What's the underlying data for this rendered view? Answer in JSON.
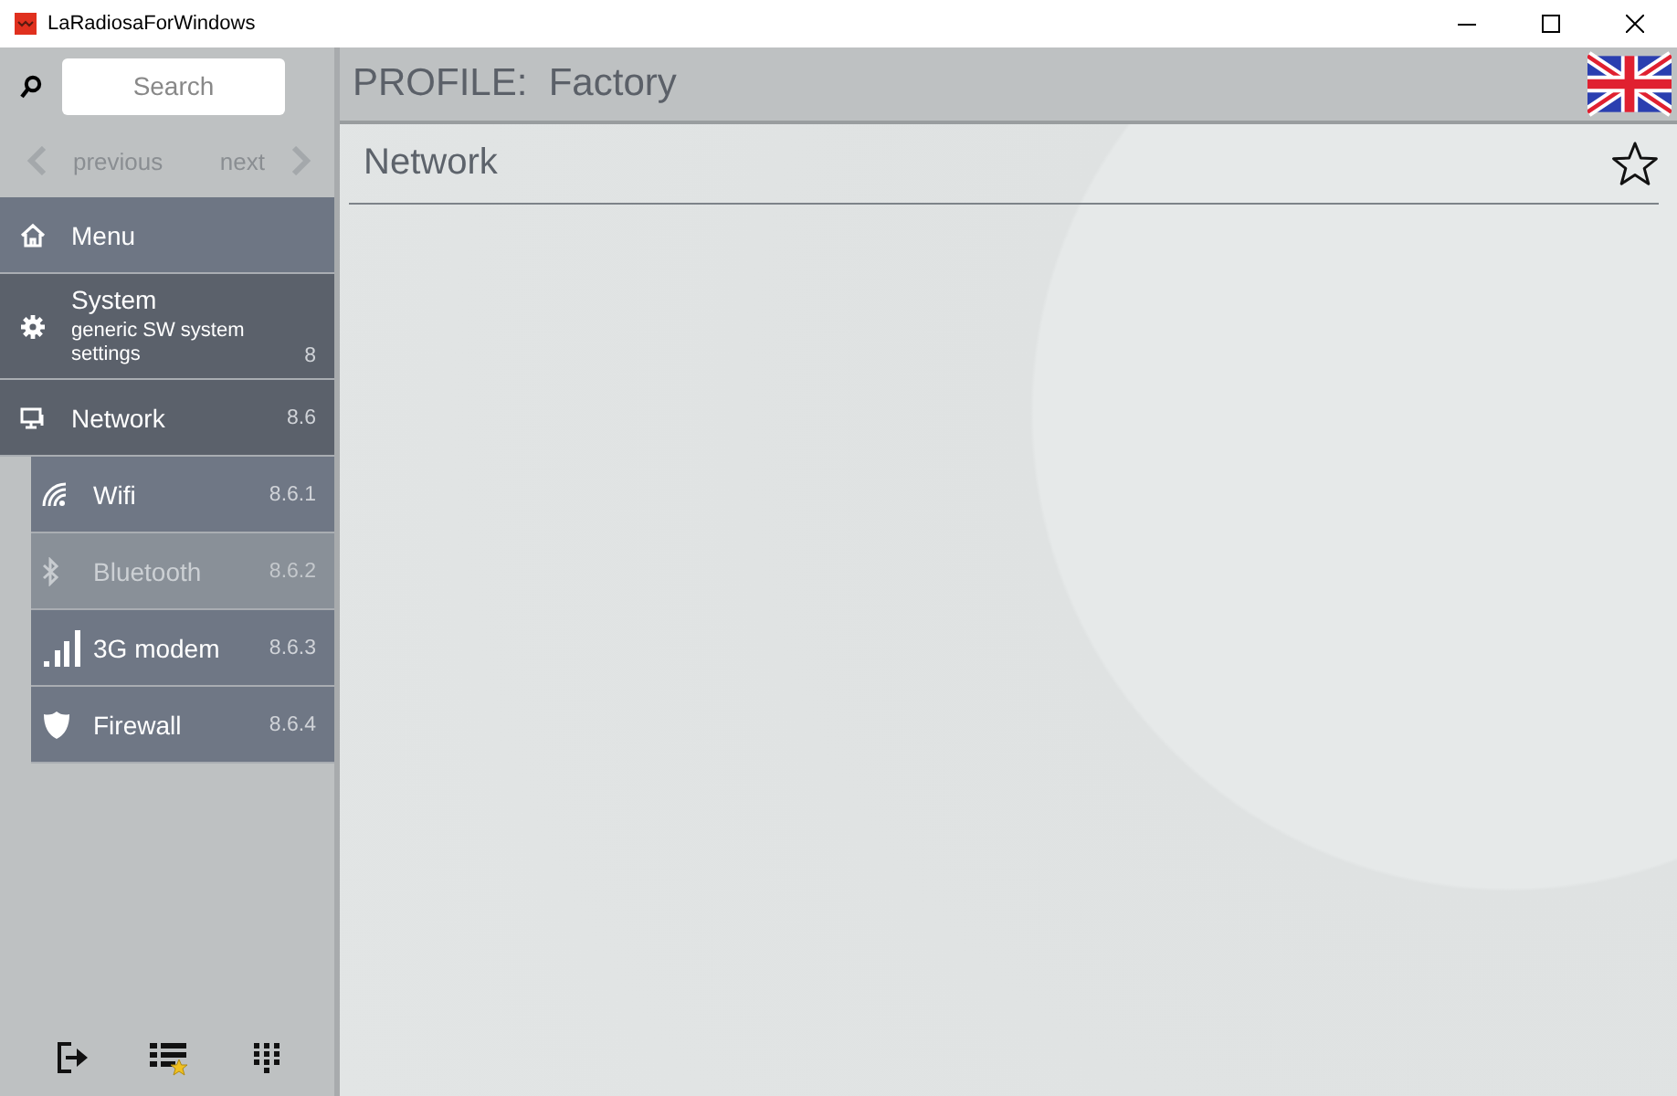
{
  "window": {
    "title": "LaRadiosaForWindows"
  },
  "search": {
    "placeholder": "Search"
  },
  "nav": [
    {
      "label": "previous",
      "disabled": true
    },
    {
      "label": "next",
      "disabled": true
    }
  ],
  "sidebar": {
    "path": [
      {
        "label": "Menu"
      },
      {
        "label": "System",
        "subtitle": "generic SW system settings",
        "number": "8"
      },
      {
        "label": "Network",
        "number": "8.6"
      }
    ],
    "items": [
      {
        "label": "Wifi",
        "number": "8.6.1",
        "disabled": false
      },
      {
        "label": "Bluetooth",
        "number": "8.6.2",
        "disabled": true
      },
      {
        "label": "3G modem",
        "number": "8.6.3",
        "disabled": false
      },
      {
        "label": "Firewall",
        "number": "8.6.4",
        "disabled": false
      }
    ]
  },
  "header": {
    "profile": "PROFILE:  Factory"
  },
  "page": {
    "title": "Network",
    "favorite": false
  }
}
